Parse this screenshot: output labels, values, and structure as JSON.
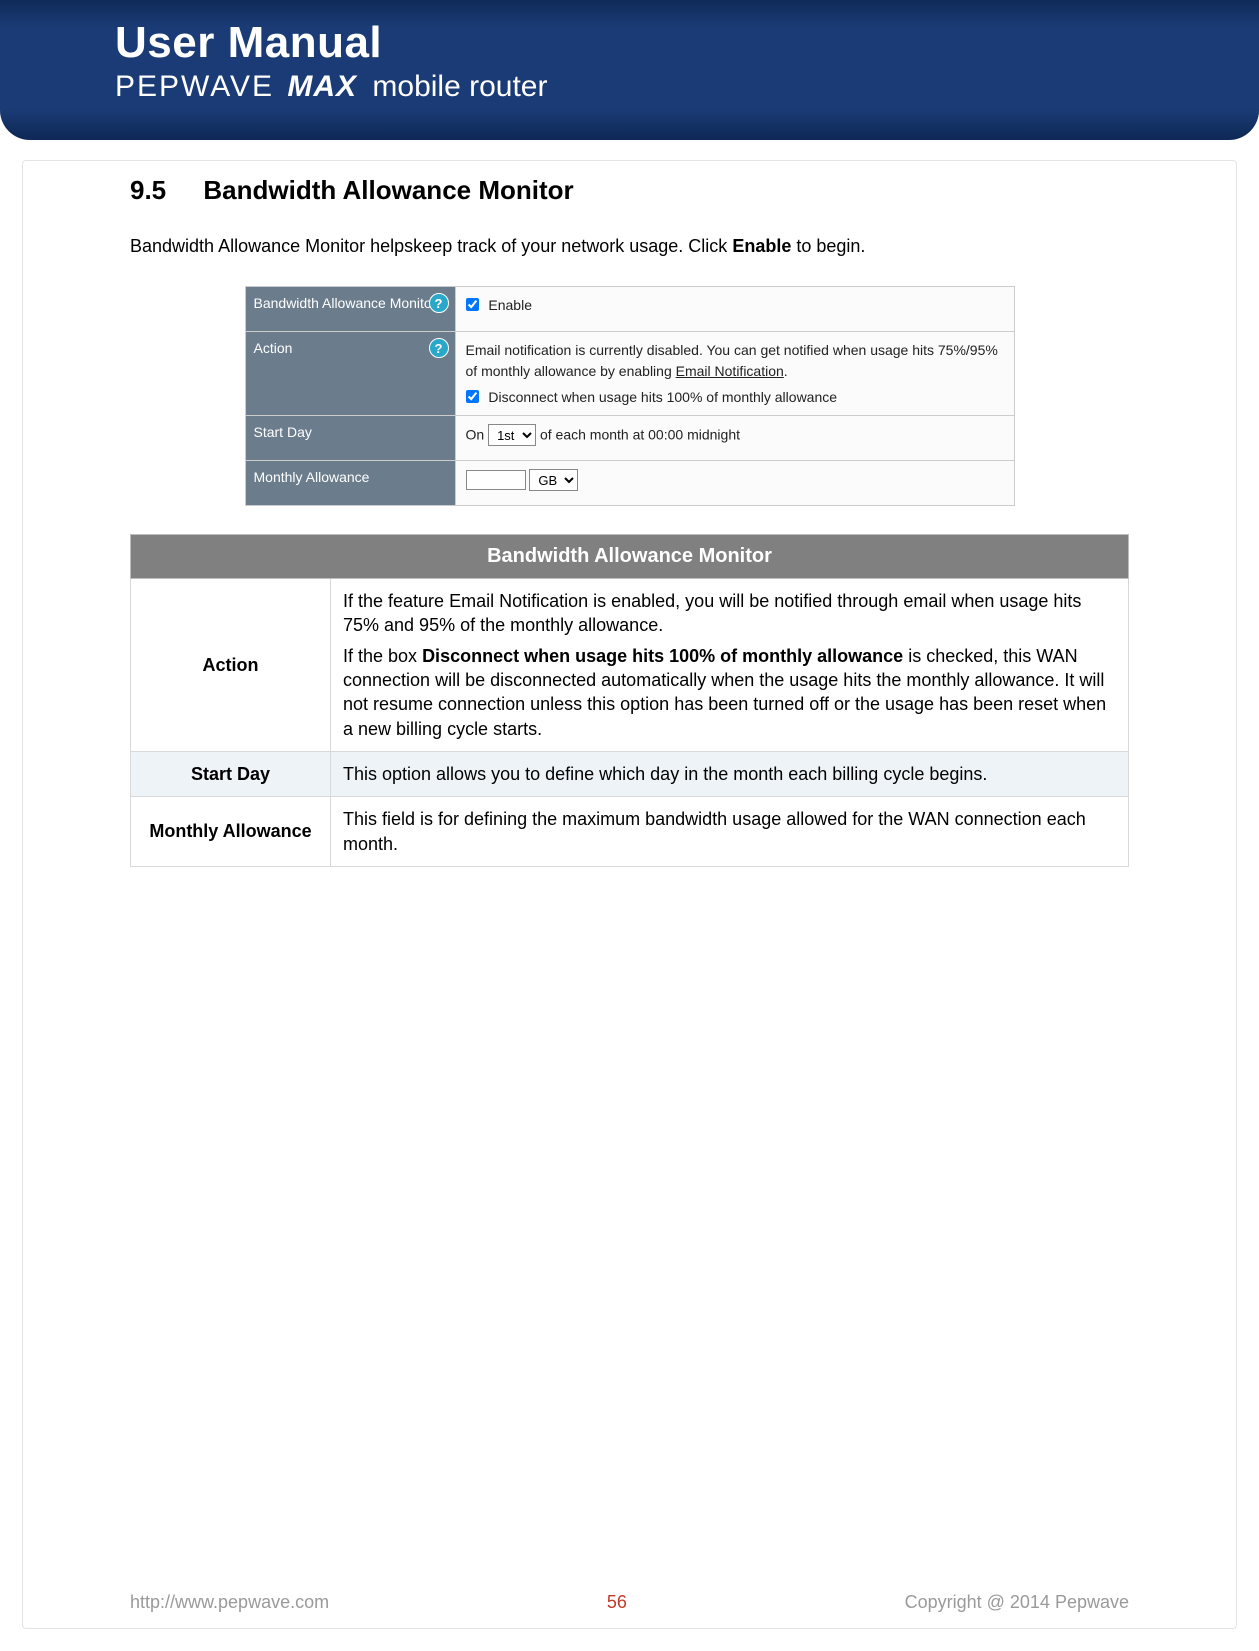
{
  "header": {
    "title": "User Manual",
    "brand": "PEPWAVE",
    "model": "MAX",
    "product_rest": "mobile router"
  },
  "section": {
    "number": "9.5",
    "title": "Bandwidth Allowance Monitor",
    "intro_pre": "Bandwidth Allowance Monitor helpskeep track of your network usage. Click ",
    "intro_bold": "Enable",
    "intro_post": " to begin."
  },
  "config_panel": {
    "rows": {
      "monitor": {
        "label": "Bandwidth Allowance Monitor",
        "enable_label": "Enable",
        "enable_checked": true
      },
      "action": {
        "label": "Action",
        "email_text_pre": "Email notification is currently disabled. You can get notified when usage hits 75%/95% of monthly allowance by enabling ",
        "email_link": "Email Notification",
        "email_text_post": ".",
        "disconnect_label": "Disconnect when usage hits 100% of monthly allowance",
        "disconnect_checked": true
      },
      "start_day": {
        "label": "Start Day",
        "prefix": "On",
        "selected": "1st",
        "suffix": "of each month at 00:00 midnight"
      },
      "monthly": {
        "label": "Monthly Allowance",
        "value": "",
        "unit_selected": "GB"
      }
    }
  },
  "description_table": {
    "header": "Bandwidth Allowance Monitor",
    "rows": [
      {
        "label": "Action",
        "p1": "If the feature Email Notification is enabled, you will be notified through email when usage hits 75% and 95% of the monthly allowance.",
        "p2_pre": "If the box ",
        "p2_bold": "Disconnect when usage hits 100% of monthly allowance",
        "p2_post": " is checked, this WAN connection will be disconnected automatically when the usage hits the monthly allowance. It will not resume connection unless this option has been turned off or the usage has been reset when a new billing cycle starts."
      },
      {
        "label": "Start Day",
        "text": "This option allows you to define which day in the month each billing cycle begins."
      },
      {
        "label": "Monthly Allowance",
        "text": "This field is for defining the maximum bandwidth usage allowed for the WAN connection each month."
      }
    ]
  },
  "footer": {
    "url": "http://www.pepwave.com",
    "page": "56",
    "copyright": "Copyright @ 2014 Pepwave"
  }
}
